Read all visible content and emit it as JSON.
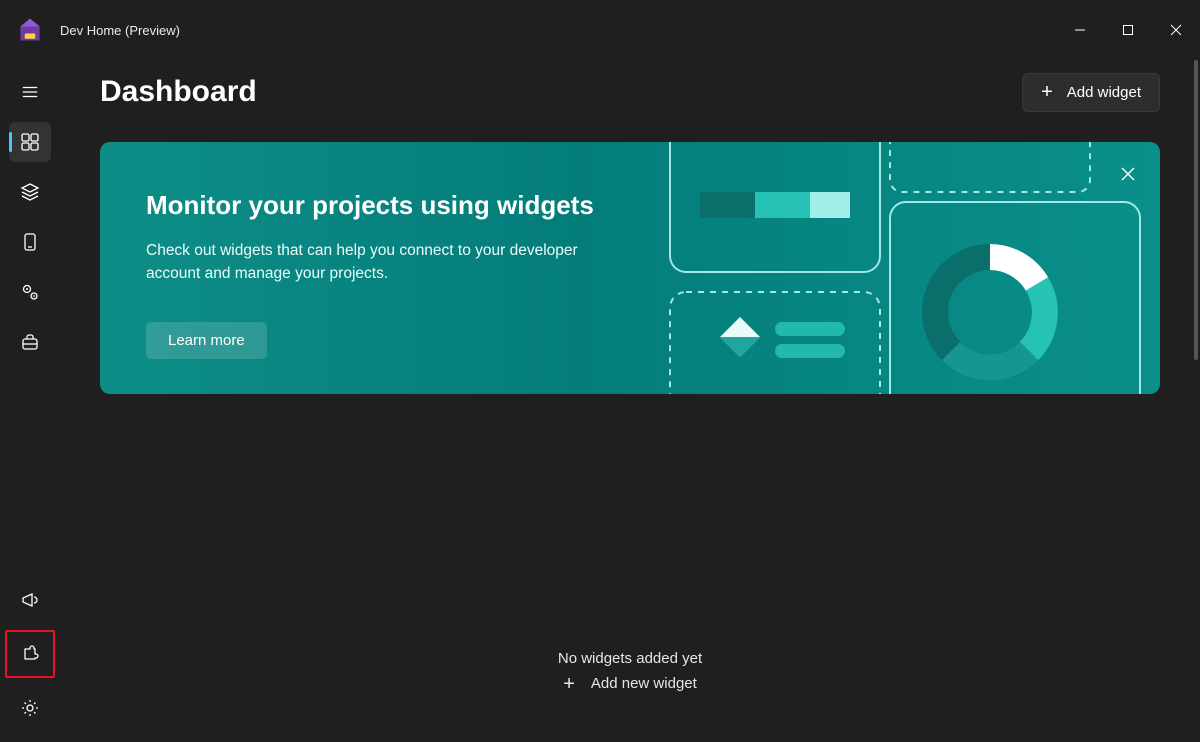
{
  "app": {
    "title": "Dev Home (Preview)"
  },
  "header": {
    "page_title": "Dashboard",
    "add_widget_label": "Add widget"
  },
  "banner": {
    "title": "Monitor your projects using widgets",
    "body": "Check out widgets that can help you connect to your developer account and manage your projects.",
    "learn_more_label": "Learn more"
  },
  "empty_state": {
    "message": "No widgets added yet",
    "add_label": "Add new widget"
  },
  "sidebar": {
    "top_items": [
      {
        "name": "dashboard",
        "active": true
      },
      {
        "name": "stacks",
        "active": false
      },
      {
        "name": "device",
        "active": false
      },
      {
        "name": "settings-gears",
        "active": false
      },
      {
        "name": "toolbox",
        "active": false
      }
    ],
    "bottom_items": [
      {
        "name": "announce",
        "highlight": false
      },
      {
        "name": "extensions",
        "highlight": true
      },
      {
        "name": "settings",
        "highlight": false
      }
    ]
  }
}
